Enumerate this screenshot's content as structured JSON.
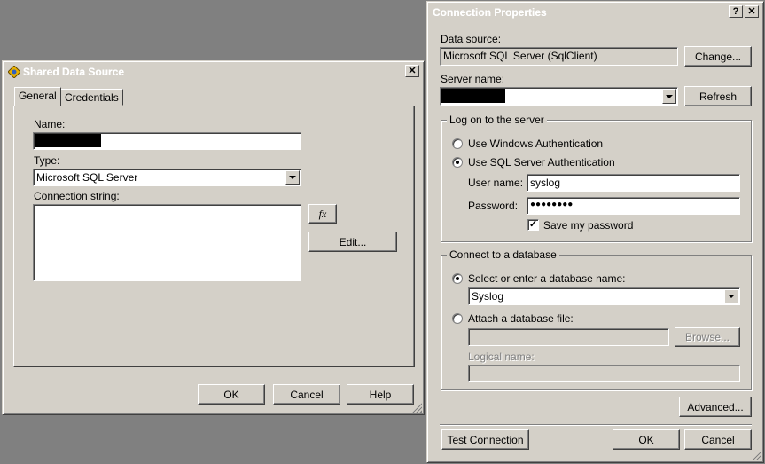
{
  "shared": {
    "title": "Shared Data Source",
    "close_glyph": "✕",
    "tabs": [
      "General",
      "Credentials"
    ],
    "name_label": "Name:",
    "type_label": "Type:",
    "type_value": "Microsoft SQL Server",
    "conn_label": "Connection string:",
    "fx_label": "fx",
    "edit_label": "Edit...",
    "ok_label": "OK",
    "cancel_label": "Cancel",
    "help_label": "Help"
  },
  "conn": {
    "title": "Connection Properties",
    "help_glyph": "?",
    "close_glyph": "✕",
    "datasource_label": "Data source:",
    "datasource_value": "Microsoft SQL Server (SqlClient)",
    "change_label": "Change...",
    "server_label": "Server name:",
    "refresh_label": "Refresh",
    "logon_group": "Log on to the server",
    "windows_auth": "Use Windows Authentication",
    "sql_auth": "Use SQL Server Authentication",
    "username_label": "User name:",
    "username_value": "syslog",
    "password_label": "Password:",
    "password_value": "●●●●●●●●",
    "save_password": "Save my password",
    "db_group": "Connect to a database",
    "select_db": "Select or enter a database name:",
    "db_value": "Syslog",
    "attach_db": "Attach a database file:",
    "browse_label": "Browse...",
    "logical_label": "Logical name:",
    "advanced_label": "Advanced...",
    "test_label": "Test Connection",
    "ok_label": "OK",
    "cancel_label": "Cancel"
  }
}
